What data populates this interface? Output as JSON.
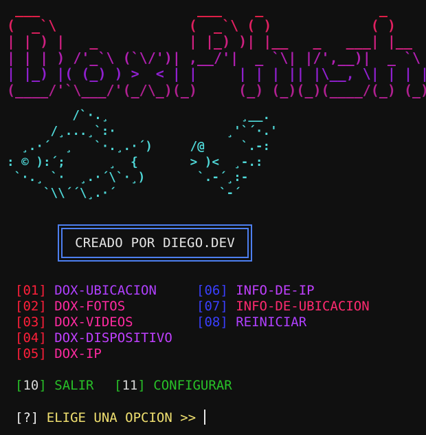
{
  "banner": {
    "lines": [
      " ___                   ___    _              _",
      "(  _`\\                (  _`\\ ( )            ( )",
      "| | ) |   _           | |_) )| |__   _   ___| |__",
      "| | | ) /'_`\\ (`\\/')| ,__/'|  _ `\\| |/',__)|  _ `\\",
      "| |_) |( (_) ) >  < | |     | | | || |\\__, \\| | | |",
      "(____/'`\\___/'(_/\\_)(_)     (_) (_)(_)(____/(_) (_)"
    ],
    "colors": [
      "#e8204a",
      "#e02060",
      "#d02080",
      "#b020b0",
      "#9020d0",
      "#b02090"
    ]
  },
  "fish_left": {
    "lines": [
      "         /`·.¸",
      "      /¸...¸`:·",
      "  ¸.·´  ¸   `·.¸.·´)",
      ": © ):´;      ¸  {",
      " `·.¸ `·  ¸.·´\\`·¸)",
      "     `\\\\´´\\¸.·´"
    ]
  },
  "fish_right": {
    "lines": [
      "        ¸__.",
      "      ¸'`´·.'",
      " /@     `.-:",
      " > )<  ¸-.:",
      "  `.-´¸:-",
      "     `-´"
    ]
  },
  "credit": "CREADO POR DIEGO.DEV",
  "menu": {
    "left": [
      {
        "num": "[01]",
        "label": "DOX-UBICACION"
      },
      {
        "num": "[02]",
        "label": "DOX-FOTOS"
      },
      {
        "num": "[03]",
        "label": "DOX-VIDEOS"
      },
      {
        "num": "[04]",
        "label": "DOX-DISPOSITIVO"
      },
      {
        "num": "[05]",
        "label": "DOX-IP"
      }
    ],
    "right": [
      {
        "num": "[06]",
        "label": "INFO-DE-IP"
      },
      {
        "num": "[07]",
        "label": "INFO-DE-UBICACION"
      },
      {
        "num": "[08]",
        "label": "REINICIAR"
      }
    ],
    "bottom": [
      {
        "open": "[",
        "num": "10",
        "close": "]",
        "label": "SALIR"
      },
      {
        "open": "[",
        "num": "11",
        "close": "]",
        "label": "CONFIGURAR"
      }
    ]
  },
  "prompt": {
    "marker": "[?]",
    "text": "ELIGE UNA OPCION >>"
  },
  "colors": {
    "background": "#101010",
    "red": "#ff1f3a",
    "blue": "#3a3fff",
    "green": "#28c028",
    "magenta": "#ff2aa0",
    "purple": "#b040ff",
    "cyan": "#4fd8d8",
    "yellow": "#f0e070",
    "border_blue": "#4d7ff0"
  }
}
